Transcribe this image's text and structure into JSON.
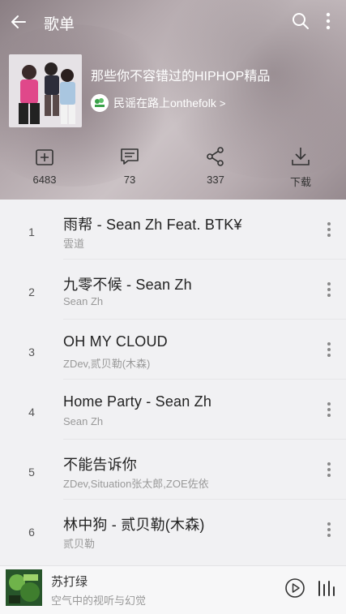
{
  "header": {
    "title": "歌单",
    "back_icon": "arrow-left-icon",
    "search_icon": "search-icon",
    "more_icon": "more-vertical-icon"
  },
  "playlist": {
    "title": "那些你不容错过的HIPHOP精品",
    "creator": "民谣在路上onthefolk",
    "creator_chevron": ">"
  },
  "actions": [
    {
      "icon": "add-to-folder-icon",
      "label": "6483"
    },
    {
      "icon": "comment-icon",
      "label": "73"
    },
    {
      "icon": "share-icon",
      "label": "337"
    },
    {
      "icon": "download-icon",
      "label": "下载"
    }
  ],
  "songs": [
    {
      "index": "1",
      "title": "雨帮 - Sean Zh Feat. BTK¥",
      "artist": "雲道"
    },
    {
      "index": "2",
      "title": "九零不候 - Sean Zh",
      "artist": "Sean Zh"
    },
    {
      "index": "3",
      "title": "OH MY CLOUD",
      "artist": "ZDev,贰贝勒(木森)"
    },
    {
      "index": "4",
      "title": "Home Party - Sean Zh",
      "artist": "Sean Zh"
    },
    {
      "index": "5",
      "title": "不能告诉你",
      "artist": "ZDev,Situation张太郎,ZOE佐依"
    },
    {
      "index": "6",
      "title": "林中狗 - 贰贝勒(木森)",
      "artist": "贰贝勒"
    }
  ],
  "player": {
    "title": "苏打绿",
    "subtitle": "空气中的视听与幻觉",
    "play_icon": "play-circle-icon",
    "queue_icon": "queue-bars-icon"
  },
  "colors": {
    "header_gradient_mid": "#cbc2c5",
    "list_background": "#f1f1f3",
    "title_text": "#222222",
    "secondary_text": "#999999"
  }
}
